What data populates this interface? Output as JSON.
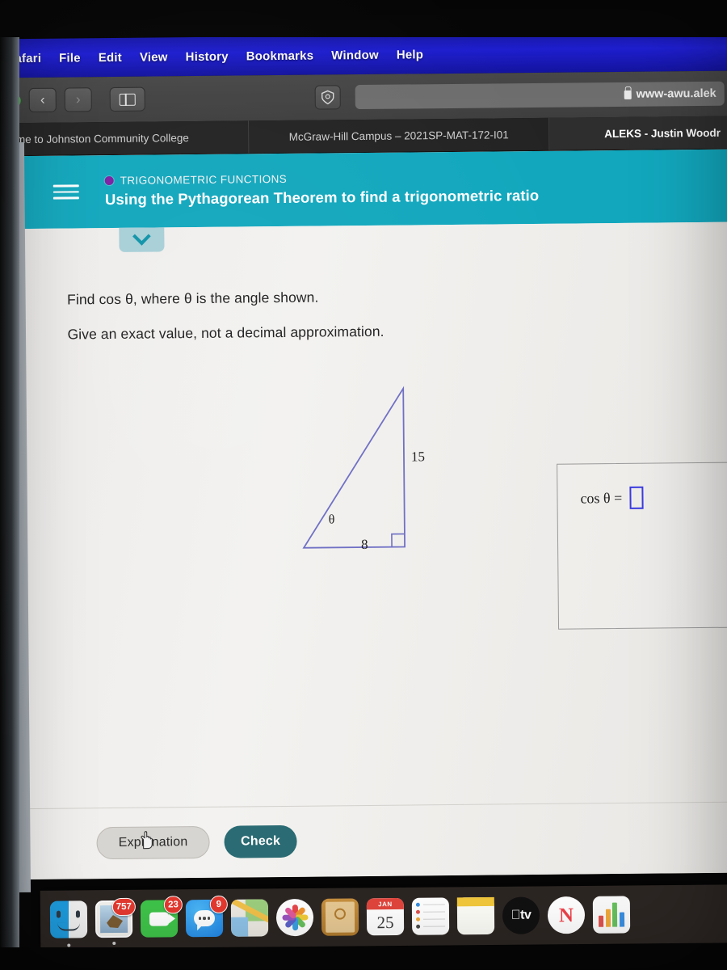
{
  "menubar": {
    "items": [
      {
        "label": "Safari",
        "active": true
      },
      {
        "label": "File"
      },
      {
        "label": "Edit"
      },
      {
        "label": "View"
      },
      {
        "label": "History"
      },
      {
        "label": "Bookmarks"
      },
      {
        "label": "Window"
      },
      {
        "label": "Help"
      }
    ]
  },
  "toolbar": {
    "back_icon": "chevron-left-icon",
    "forward_icon": "chevron-right-icon",
    "sidebar_icon": "sidebar-toggle-icon",
    "shield_icon": "privacy-shield-icon",
    "lock_icon": "lock-icon",
    "url": "www-awu.alek"
  },
  "tabs": [
    {
      "title": "elcome to Johnston Community College",
      "active": false
    },
    {
      "title": "McGraw-Hill Campus – 2021SP-MAT-172-I01",
      "active": false
    },
    {
      "title": "ALEKS - Justin Woodr",
      "active": true
    }
  ],
  "aleks": {
    "menu_icon": "hamburger-menu-icon",
    "category_dot_color": "#7b1fa2",
    "category": "TRIGONOMETRIC FUNCTIONS",
    "title": "Using the Pythagorean Theorem to find a trigonometric ratio",
    "header_color": "#12a7bd",
    "collapse_icon": "chevron-down-icon",
    "question_line_1": "Find cos θ, where θ is the angle shown.",
    "question_line_2": "Give an exact value, not a decimal approximation.",
    "figure": {
      "type": "right-triangle",
      "stroke_color": "#6d6dc4",
      "opposite_label": "15",
      "adjacent_label": "8",
      "angle_label": "θ",
      "right_angle_marker": true
    },
    "answer": {
      "expression": "cos θ  =",
      "input_value": "",
      "input_border_color": "#3b3be0"
    },
    "buttons": {
      "explanation": "Explanation",
      "check": "Check",
      "check_color": "#2b6b73"
    },
    "cursor_icon": "pointing-hand-cursor"
  },
  "dock": {
    "items": [
      {
        "name": "finder",
        "badge": null
      },
      {
        "name": "mail",
        "badge": "757"
      },
      {
        "name": "facetime",
        "badge": "23"
      },
      {
        "name": "messages",
        "badge": "9"
      },
      {
        "name": "maps",
        "badge": null
      },
      {
        "name": "photos",
        "badge": null
      },
      {
        "name": "contacts",
        "badge": null
      },
      {
        "name": "calendar",
        "badge": null,
        "month": "JAN",
        "day": "25"
      },
      {
        "name": "reminders",
        "badge": null
      },
      {
        "name": "notes",
        "badge": null
      },
      {
        "name": "tv",
        "badge": null,
        "label": "tv"
      },
      {
        "name": "news",
        "badge": null,
        "label": "N"
      },
      {
        "name": "numbers",
        "badge": null
      }
    ]
  }
}
